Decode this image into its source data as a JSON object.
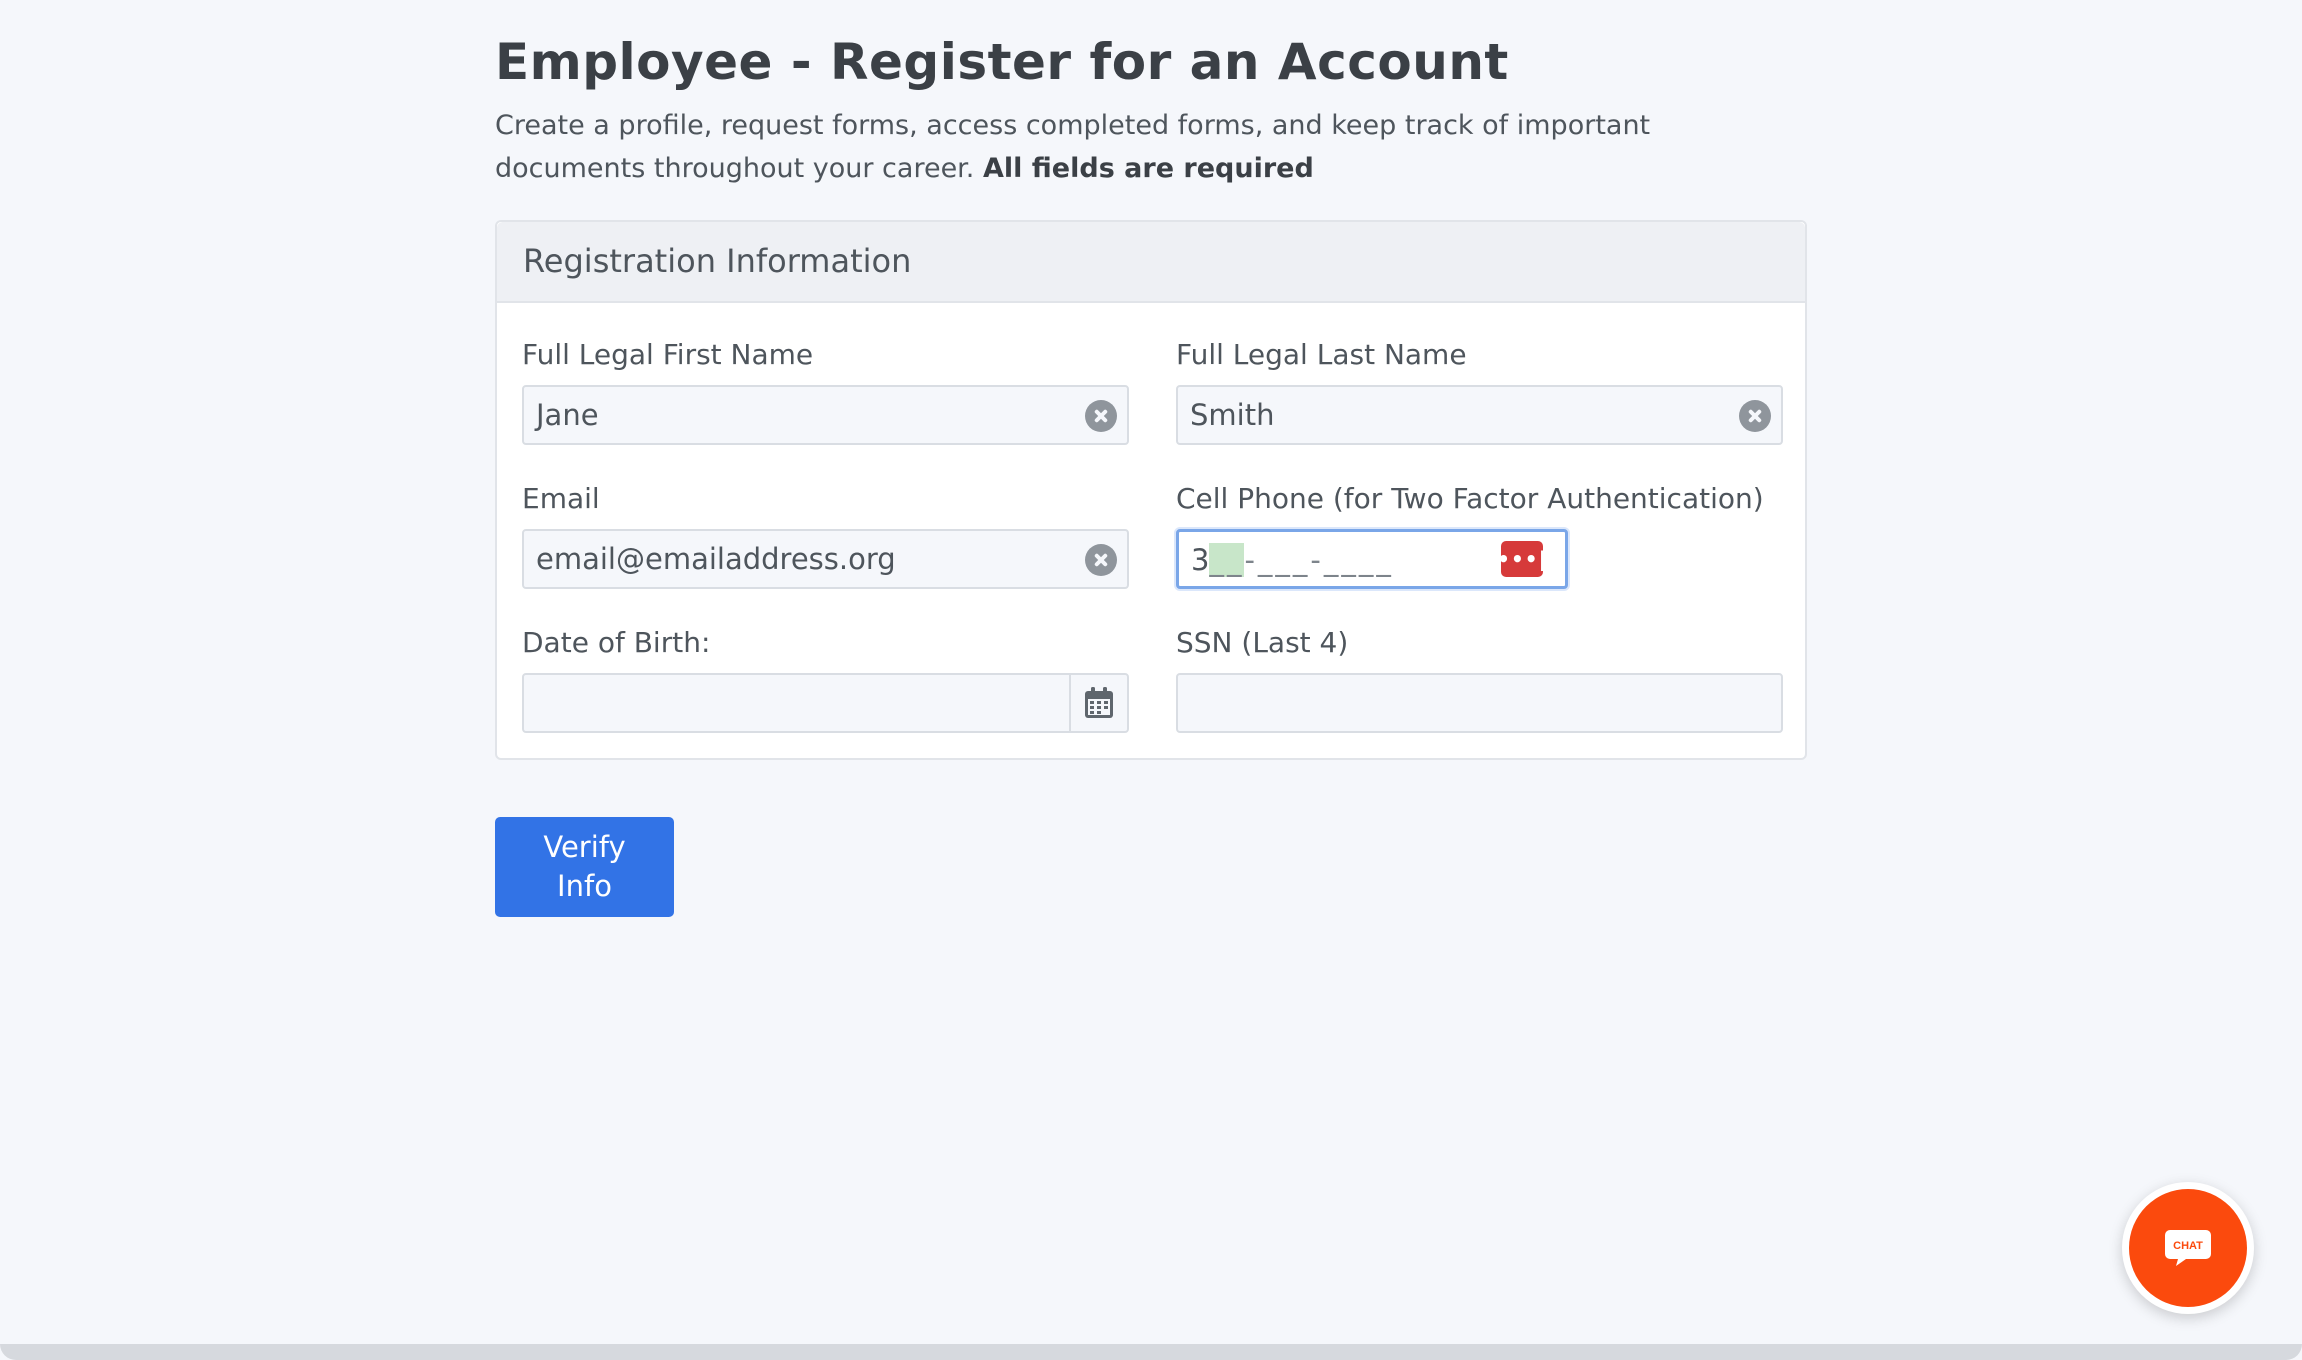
{
  "page": {
    "title": "Employee - Register for an Account",
    "intro": "Create a profile, request forms, access completed forms, and keep track of important documents throughout your career.",
    "intro_bold": "All fields are required"
  },
  "card": {
    "header": "Registration Information"
  },
  "fields": {
    "first_name": {
      "label": "Full Legal First Name",
      "value": "Jane"
    },
    "last_name": {
      "label": "Full Legal Last Name",
      "value": "Smith"
    },
    "email": {
      "label": "Email",
      "value": "email@emailaddress.org"
    },
    "phone": {
      "label": "Cell Phone (for Two Factor Authentication)",
      "typed": "3",
      "cursor_mask": "__",
      "rest_mask": "-___-____"
    },
    "dob": {
      "label": "Date of Birth:",
      "value": ""
    },
    "ssn": {
      "label": "SSN (Last 4)",
      "value": ""
    }
  },
  "actions": {
    "verify_line1": "Verify",
    "verify_line2": "Info"
  },
  "chat": {
    "label": "CHAT"
  },
  "colors": {
    "primary": "#3273e6",
    "chat": "#fb4a0d",
    "password_manager": "#d63a3a",
    "mask_highlight": "#c8e6c9"
  },
  "icons": [
    "clear-icon",
    "password-manager-icon",
    "calendar-icon",
    "chat-icon"
  ]
}
